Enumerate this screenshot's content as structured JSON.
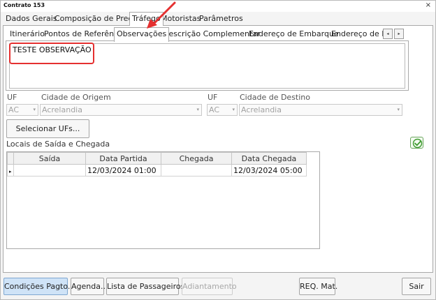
{
  "window": {
    "title": "Contrato 153",
    "close_symbol": "×"
  },
  "top_tabs": [
    {
      "label": "Dados Gerais"
    },
    {
      "label": "Composição de Preço"
    },
    {
      "label": "Tráfego"
    },
    {
      "label": "Motoristas"
    },
    {
      "label": "Parâmetros"
    }
  ],
  "sub_tabs": [
    {
      "label": "Itinerário"
    },
    {
      "label": "Pontos de Referência"
    },
    {
      "label": "Observações"
    },
    {
      "label": "Descrição Complementar"
    },
    {
      "label": "Endereço de Embarque"
    },
    {
      "label": "Endereço de De"
    }
  ],
  "tab_scroll": {
    "left": "◂",
    "right": "▸"
  },
  "observacoes": {
    "text": "TESTE OBSERVAÇÃO"
  },
  "origem": {
    "uf_label": "UF",
    "uf_value": "AC",
    "cidade_label": "Cidade de Origem",
    "cidade_value": "Acrelandia"
  },
  "destino": {
    "uf_label": "UF",
    "uf_value": "AC",
    "cidade_label": "Cidade de Destino",
    "cidade_value": "Acrelandia"
  },
  "combo_arrow": "▾",
  "selecionar_ufs_label": "Selecionar UFs...",
  "locais": {
    "label": "Locais de  Saída e Chegada",
    "columns": [
      "Saída",
      "Data Partida",
      "Chegada",
      "Data Chegada"
    ],
    "rows": [
      {
        "marker": "▸",
        "saida": "",
        "data_partida": "12/03/2024 01:00",
        "chegada": "",
        "data_chegada": "12/03/2024 05:00"
      }
    ]
  },
  "bottom_buttons": {
    "condicoes": "Condições Pagto...",
    "agenda": "Agenda...",
    "passageiros": "Lista de Passageiros...",
    "adiantamento": "Adiantamento",
    "req_mat": "REQ. Mat.",
    "sair": "Sair"
  },
  "colors": {
    "accent": "#cfe3f7",
    "annotation": "#e53030",
    "check": "#3c9a2e"
  }
}
